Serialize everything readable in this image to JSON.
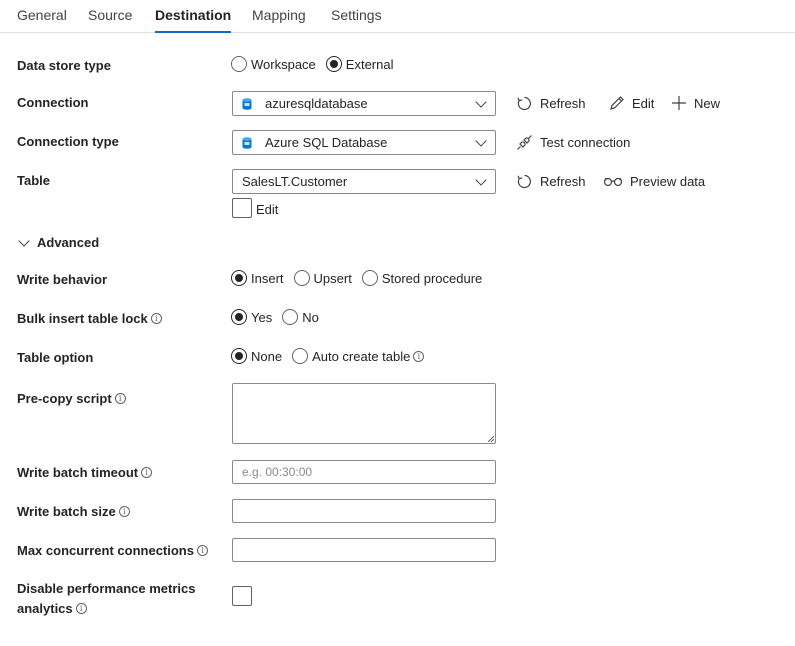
{
  "tabs": [
    {
      "label": "General",
      "active": false
    },
    {
      "label": "Source",
      "active": false
    },
    {
      "label": "Destination",
      "active": true
    },
    {
      "label": "Mapping",
      "active": false
    },
    {
      "label": "Settings",
      "active": false
    }
  ],
  "data_store_type": {
    "label": "Data store type",
    "options": [
      "Workspace",
      "External"
    ],
    "selected": "External"
  },
  "connection": {
    "label": "Connection",
    "value": "azuresqldatabase",
    "refresh_label": "Refresh",
    "edit_label": "Edit",
    "new_label": "New"
  },
  "connection_type": {
    "label": "Connection type",
    "value": "Azure SQL Database",
    "test_label": "Test connection"
  },
  "table": {
    "label": "Table",
    "value": "SalesLT.Customer",
    "refresh_label": "Refresh",
    "preview_label": "Preview data",
    "edit_checkbox_label": "Edit"
  },
  "advanced": {
    "label": "Advanced",
    "expanded": true
  },
  "write_behavior": {
    "label": "Write behavior",
    "options": [
      "Insert",
      "Upsert",
      "Stored procedure"
    ],
    "selected": "Insert"
  },
  "bulk_insert_table_lock": {
    "label": "Bulk insert table lock",
    "options": [
      "Yes",
      "No"
    ],
    "selected": "Yes"
  },
  "table_option": {
    "label": "Table option",
    "options": [
      "None",
      "Auto create table"
    ],
    "selected": "None"
  },
  "pre_copy_script": {
    "label": "Pre-copy script",
    "value": ""
  },
  "write_batch_timeout": {
    "label": "Write batch timeout",
    "value": "",
    "placeholder": "e.g. 00:30:00"
  },
  "write_batch_size": {
    "label": "Write batch size",
    "value": ""
  },
  "max_concurrent_connections": {
    "label": "Max concurrent connections",
    "value": ""
  },
  "disable_performance_metrics": {
    "label_line1": "Disable performance metrics",
    "label_line2": "analytics",
    "checked": false
  },
  "colors": {
    "accent": "#0f6cbd",
    "text": "#242424",
    "border": "#8a8a8a",
    "db_icon": "#0078d4"
  }
}
